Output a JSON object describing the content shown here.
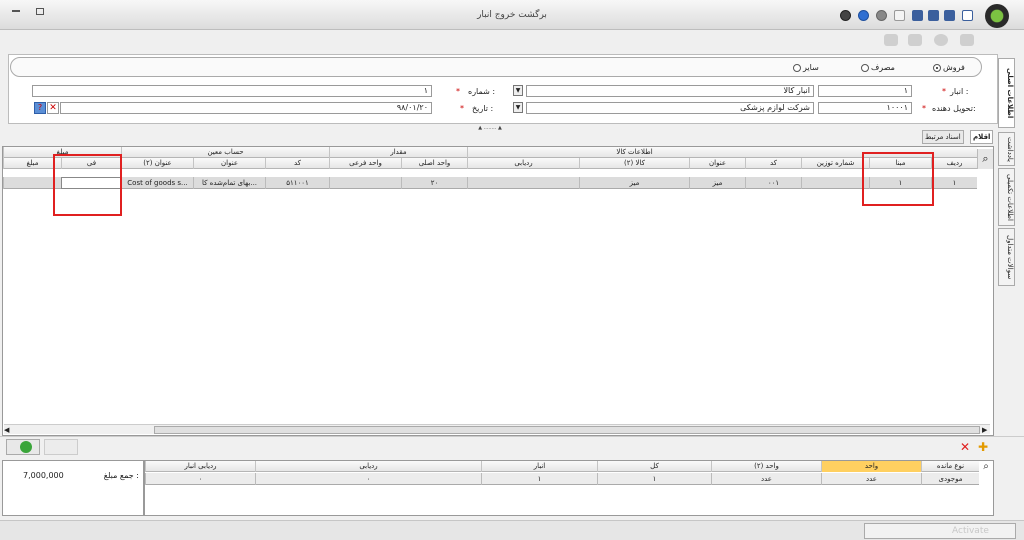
{
  "window": {
    "title": "برگشت خروج انبار"
  },
  "radios": [
    {
      "label": "فروش",
      "selected": true
    },
    {
      "label": "مصرف",
      "selected": false
    },
    {
      "label": "سایر",
      "selected": false
    }
  ],
  "form": {
    "anbar_label": "انبار :",
    "anbar_code": "۱",
    "anbar_name": "انبار کالا",
    "shomare_label": "شماره :",
    "shomare_value": "۱",
    "tahvil_label": "تحویل دهنده:",
    "tahvil_code": "۱۰۰۰۱",
    "tahvil_name": "شرکت لوازم پزشکی",
    "tarikh_label": "تاریخ :",
    "tarikh_value": "۹۸/۰۱/۲۰"
  },
  "side_tabs": [
    "اطلاعات اصلی",
    "یادداشت",
    "اطلاعات تکمیلی",
    "سوالات متداول"
  ],
  "tabs": [
    "اقلام",
    "اسناد مرتبط"
  ],
  "grid": {
    "group_headers": {
      "kala": "اطلاعات کالا",
      "meghdar": "مقدار",
      "hesab": "حساب معین",
      "mablagh": "مبلغ"
    },
    "columns": {
      "radif": "ردیف",
      "mabna": "مبنا",
      "shomare_tozin": "شماره توزین",
      "kod": "کد",
      "onvan": "عنوان",
      "kala2": "کالا (۲)",
      "radyabi": "ردیابی",
      "vahed_asli": "واحد اصلی",
      "vahed_farei": "واحد فرعی",
      "hesab_kod": "کد",
      "hesab_onvan": "عنوان",
      "hesab_onvan2": "عنوان (۲)",
      "fi": "فی",
      "mablagh": "مبلغ"
    },
    "row": {
      "radif": "۱",
      "mabna": "۱",
      "shomare_tozin": "",
      "kod": "۰۰۱",
      "onvan": "میز",
      "kala2": "میز",
      "radyabi": "",
      "vahed_asli": "۲۰",
      "vahed_farei": "",
      "hesab_kod": "۵۱۱۰۰۱",
      "hesab_onvan": "بهای تمام‌شده کا...",
      "hesab_onvan2": "Cost of goods s...",
      "fi": "",
      "mablagh": ""
    }
  },
  "summary": {
    "label": "جمع مبلغ :",
    "value": "7,000,000"
  },
  "bottom_grid": {
    "columns": {
      "noe_mande": "نوع مانده",
      "vahed": "واحد",
      "vahed2": "واحد (۲)",
      "kol": "کل",
      "anbar": "انبار",
      "radyabi": "ردیابی",
      "radyabi_anbar": "ردیابی انبار"
    },
    "row": {
      "noe_mande": "موجودی",
      "vahed": "عدد",
      "vahed2": "عدد",
      "kol": "۱",
      "anbar": "۱",
      "radyabi": "۰",
      "radyabi_anbar": "۰"
    }
  },
  "watermark": "Activate"
}
